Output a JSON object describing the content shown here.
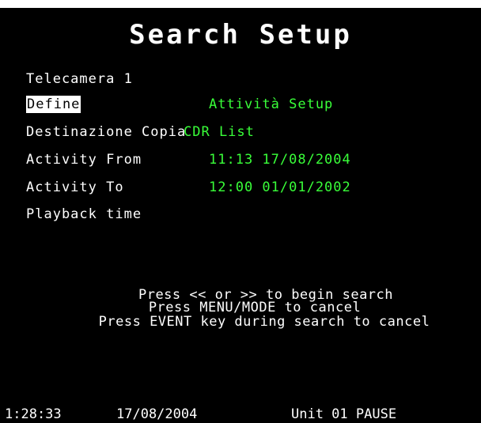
{
  "title": "Search Setup",
  "camera": "Telecamera 1",
  "fields": {
    "define": {
      "label": "Define",
      "value": "Attività  Setup"
    },
    "destination": {
      "label": "Destinazione Copia",
      "value": "CDR List"
    },
    "activity_from": {
      "label": "Activity From",
      "value": "11:13 17/08/2004"
    },
    "activity_to": {
      "label": "Activity To",
      "value": "12:00 01/01/2002"
    },
    "playback": {
      "label": "Playback time"
    }
  },
  "instructions": {
    "line1": "Press << or >> to begin search",
    "line2": "Press MENU/MODE to cancel",
    "line3": "Press EVENT key during search to cancel"
  },
  "status_bar": {
    "time": "1:28:33",
    "date": "17/08/2004",
    "unit": "Unit 01 PAUSE"
  },
  "colors": {
    "background": "#000000",
    "text": "#ffffff",
    "value": "#39ff39"
  }
}
